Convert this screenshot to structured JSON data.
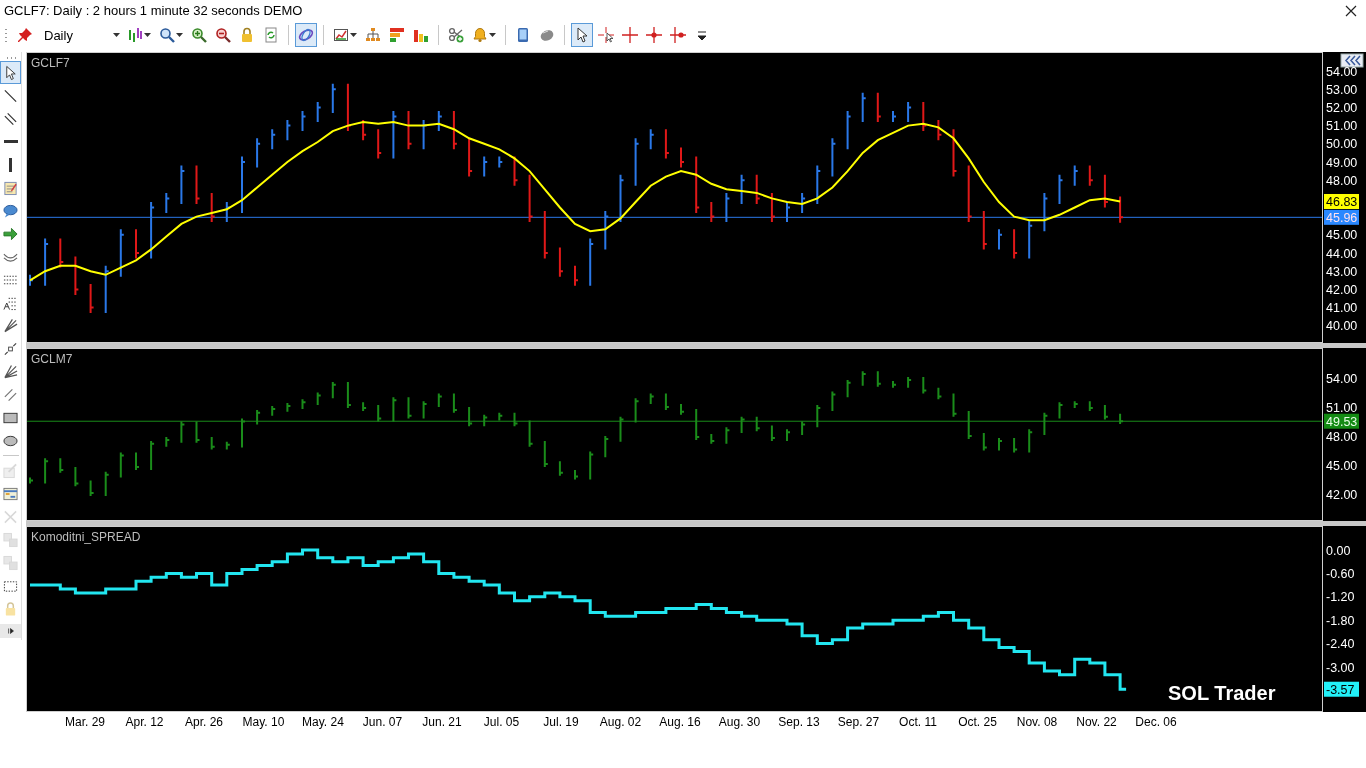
{
  "window": {
    "title": "GCLF7: Daily : 2 hours 1 minute 32 seconds DEMO"
  },
  "toolbar": {
    "groups": [
      [
        {
          "kind": "pin",
          "selected": false
        },
        {
          "kind": "period",
          "label": "Daily"
        },
        {
          "kind": "bars",
          "selected": false
        },
        {
          "kind": "search",
          "selected": false
        },
        {
          "kind": "zoom-in",
          "selected": false
        },
        {
          "kind": "zoom-out",
          "selected": false
        },
        {
          "kind": "lock",
          "selected": false
        },
        {
          "kind": "refresh",
          "selected": false
        }
      ],
      [
        {
          "kind": "swirl",
          "selected": true
        }
      ],
      [
        {
          "kind": "chart",
          "selected": false
        },
        {
          "kind": "hierarchy",
          "selected": false
        },
        {
          "kind": "colored-bars",
          "selected": false
        },
        {
          "kind": "bar-chart",
          "selected": false
        }
      ],
      [
        {
          "kind": "scissors",
          "selected": false
        },
        {
          "kind": "bell",
          "selected": false
        }
      ],
      [
        {
          "kind": "tablet",
          "selected": false
        },
        {
          "kind": "mouse",
          "selected": false
        }
      ],
      [
        {
          "kind": "pointer",
          "selected": true
        },
        {
          "kind": "crosshair-pointer",
          "selected": false
        },
        {
          "kind": "crosshair",
          "selected": false
        },
        {
          "kind": "crosshair-dot",
          "selected": false
        },
        {
          "kind": "crosshair-marker",
          "selected": false
        },
        {
          "kind": "overflow",
          "selected": false
        }
      ]
    ]
  },
  "drawing_tools": {
    "groups": [
      [
        {
          "kind": "pointer",
          "selected": true,
          "disabled": false
        },
        {
          "kind": "line",
          "selected": false,
          "disabled": false
        },
        {
          "kind": "parallel-lines",
          "selected": false,
          "disabled": false
        },
        {
          "kind": "horizontal-line",
          "selected": false,
          "disabled": false
        },
        {
          "kind": "vertical-line",
          "selected": false,
          "disabled": false
        },
        {
          "kind": "note",
          "selected": false,
          "disabled": false
        },
        {
          "kind": "callout",
          "selected": false,
          "disabled": false
        },
        {
          "kind": "arrow",
          "selected": false,
          "disabled": false
        },
        {
          "kind": "arc",
          "selected": false,
          "disabled": false
        },
        {
          "kind": "level-lines",
          "selected": false,
          "disabled": false
        },
        {
          "kind": "text-levels",
          "selected": false,
          "disabled": false
        },
        {
          "kind": "fan",
          "selected": false,
          "disabled": false
        },
        {
          "kind": "segment",
          "selected": false,
          "disabled": false
        },
        {
          "kind": "fan-lines",
          "selected": false,
          "disabled": false
        },
        {
          "kind": "channel",
          "selected": false,
          "disabled": false
        },
        {
          "kind": "rectangle",
          "selected": false,
          "disabled": false
        },
        {
          "kind": "ellipse",
          "selected": false,
          "disabled": false
        }
      ],
      [
        {
          "kind": "edit",
          "selected": false,
          "disabled": true
        },
        {
          "kind": "table",
          "selected": false,
          "disabled": false
        },
        {
          "kind": "delete",
          "selected": false,
          "disabled": true
        },
        {
          "kind": "layers",
          "selected": false,
          "disabled": true
        },
        {
          "kind": "layers",
          "selected": false,
          "disabled": true
        },
        {
          "kind": "selection",
          "selected": false,
          "disabled": false
        },
        {
          "kind": "lock",
          "selected": false,
          "disabled": true
        },
        {
          "kind": "expand",
          "selected": false,
          "disabled": false
        }
      ]
    ]
  },
  "panels": [
    {
      "kind": "price",
      "title": "GCLF7",
      "tags": [
        {
          "text": "46.83",
          "color": "#ffff00"
        },
        {
          "text": "45.96",
          "color": "#2a88ff"
        }
      ],
      "axis_labels": [
        [
          "54.00",
          "53.00",
          "52.00",
          "51.00",
          "50.00",
          "49.00",
          "48.00"
        ],
        [
          "45.00",
          "44.00",
          "43.00",
          "42.00",
          "41.00",
          "40.00"
        ]
      ]
    },
    {
      "kind": "bars",
      "title": "GCLM7",
      "axis_labels": [
        "54.00",
        "51.00",
        "48.00",
        "45.00",
        "42.00"
      ],
      "tags": [
        {
          "text": "49.53",
          "color": "#138a13"
        }
      ]
    },
    {
      "kind": "step",
      "title": "Komoditni_SPREAD",
      "tags": [
        {
          "text": "-3.57",
          "color": "#22f0f8"
        }
      ],
      "axis_labels": [
        "0.00",
        "-0.60",
        "-1.20",
        "-1.80",
        "-2.40",
        "-3.00"
      ],
      "logo": "SOL Trader"
    }
  ],
  "x_axis": {
    "labels": [
      "Mar. 29",
      "Apr. 12",
      "Apr. 26",
      "May. 10",
      "May. 24",
      "Jun. 07",
      "Jun. 21",
      "Jul. 05",
      "Jul. 19",
      "Aug. 02",
      "Aug. 16",
      "Aug. 30",
      "Sep. 13",
      "Sep. 27",
      "Oct. 11",
      "Oct. 25",
      "Nov. 08",
      "Nov. 22",
      "Dec. 06"
    ]
  }
}
